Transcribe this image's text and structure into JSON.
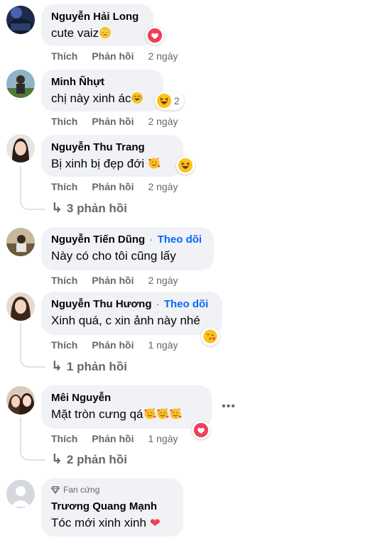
{
  "labels": {
    "like": "Thích",
    "reply": "Phản hồi"
  },
  "comments": [
    {
      "author": "Nguyễn Hải Long",
      "text": "cute vaiz",
      "time": "2 ngày",
      "reaction_count": ""
    },
    {
      "author": "Minh Ñhựt",
      "text": "chị này xinh ác",
      "time": "2 ngày",
      "reaction_count": "2"
    },
    {
      "author": "Nguyễn Thu Trang",
      "text": "Bị xinh bị đẹp đới",
      "time": "2 ngày",
      "replies": "3 phản hồi"
    },
    {
      "author": "Nguyễn Tiến Dũng",
      "follow": "Theo dõi",
      "text": "Này có cho tôi cũng lấy",
      "time": "2 ngày"
    },
    {
      "author": "Nguyễn Thu Hương",
      "follow": "Theo dõi",
      "text": "Xinh quá, c xin ảnh này nhé",
      "time": "1 ngày",
      "replies": "1 phản hồi"
    },
    {
      "author": "Mêi Nguyễn",
      "text": "Mặt tròn cưng qá",
      "time": "1 ngày",
      "replies": "2 phản hồi"
    },
    {
      "author": "Trương Quang Mạnh",
      "badge": "Fan cứng",
      "text": "Tóc mới xinh xinh"
    }
  ],
  "icons": {
    "heart": "heart-reaction-icon",
    "laugh": "haha-reaction-icon",
    "love_face": "smiling-face-with-hearts-emoji",
    "tears": "face-holding-back-tears-emoji",
    "joy": "face-with-tears-of-joy-emoji",
    "kiss": "face-blowing-kiss-emoji",
    "diamond": "diamond-badge-icon",
    "more": "more-options-icon"
  },
  "colors": {
    "accent": "#0866ff",
    "bubble": "#f0f2f5",
    "muted": "#65676b",
    "heart": "#f33e58",
    "emoji": "#fcc21b"
  }
}
